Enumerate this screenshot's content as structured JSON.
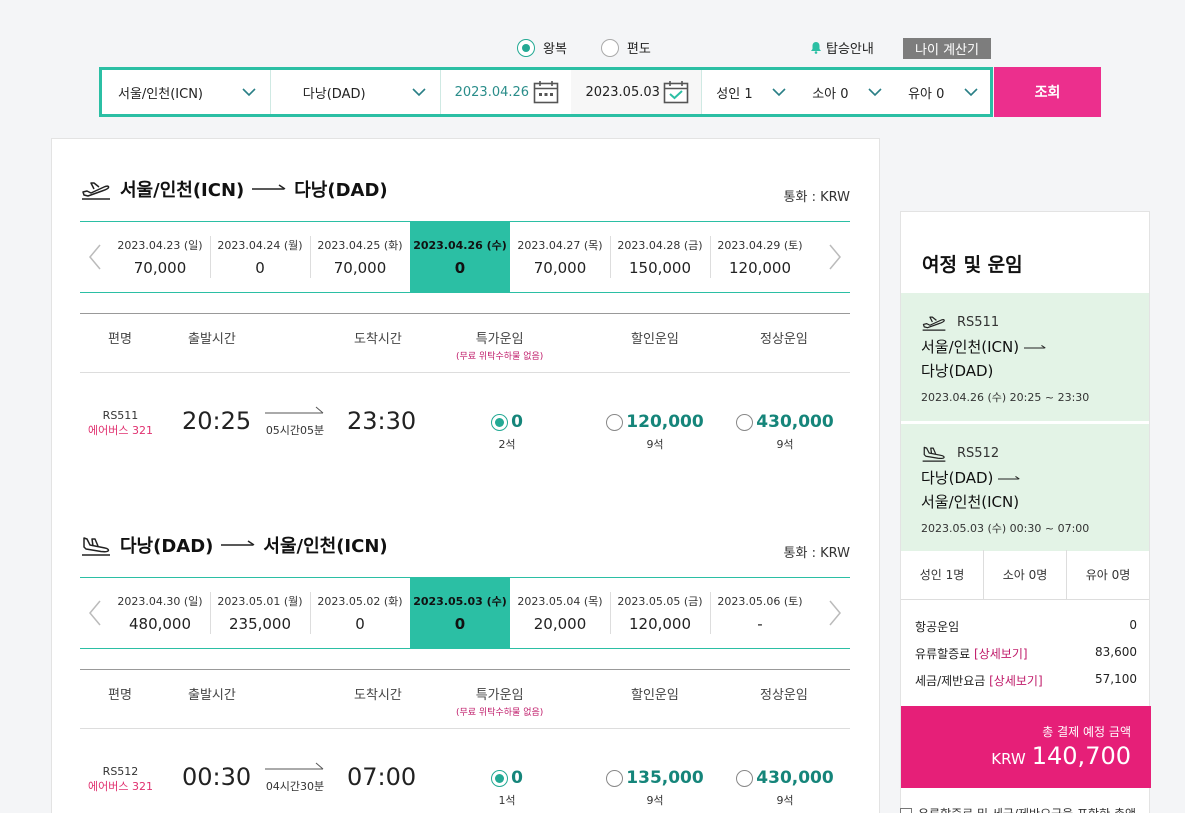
{
  "trip_type": {
    "options": [
      "왕복",
      "편도"
    ],
    "selected": 0
  },
  "boarding_info": "탑승안내",
  "age_calculator": "나이 계산기",
  "search": {
    "origin": "서울/인천(ICN)",
    "destination": "다낭(DAD)",
    "depart_date": "2023.04.26",
    "return_date": "2023.05.03",
    "adult": "성인 1",
    "child": "소아 0",
    "infant": "유아 0",
    "button": "조회"
  },
  "outbound": {
    "title_from": "서울/인천(ICN)",
    "title_to": "다낭(DAD)",
    "currency": "통화 : KRW",
    "dates": [
      {
        "date": "2023.04.23 (일)",
        "price": "70,000"
      },
      {
        "date": "2023.04.24 (월)",
        "price": "0"
      },
      {
        "date": "2023.04.25 (화)",
        "price": "70,000"
      },
      {
        "date": "2023.04.26 (수)",
        "price": "0"
      },
      {
        "date": "2023.04.27 (목)",
        "price": "70,000"
      },
      {
        "date": "2023.04.28 (금)",
        "price": "150,000"
      },
      {
        "date": "2023.04.29 (토)",
        "price": "120,000"
      }
    ],
    "active_index": 3,
    "headers": {
      "flight": "편명",
      "dep": "출발시간",
      "arr": "도착시간",
      "special": "특가운임",
      "special_note": "(무료 위탁수하물 없음)",
      "discount": "할인운임",
      "normal": "정상운임"
    },
    "flight": {
      "no": "RS511",
      "aircraft": "에어버스 321",
      "dep": "20:25",
      "arr": "23:30",
      "duration": "05시간05분",
      "fares": [
        {
          "price": "0",
          "seats": "2석",
          "selected": true
        },
        {
          "price": "120,000",
          "seats": "9석",
          "selected": false
        },
        {
          "price": "430,000",
          "seats": "9석",
          "selected": false
        }
      ]
    }
  },
  "inbound": {
    "title_from": "다낭(DAD)",
    "title_to": "서울/인천(ICN)",
    "currency": "통화 : KRW",
    "dates": [
      {
        "date": "2023.04.30 (일)",
        "price": "480,000"
      },
      {
        "date": "2023.05.01 (월)",
        "price": "235,000"
      },
      {
        "date": "2023.05.02 (화)",
        "price": "0"
      },
      {
        "date": "2023.05.03 (수)",
        "price": "0"
      },
      {
        "date": "2023.05.04 (목)",
        "price": "20,000"
      },
      {
        "date": "2023.05.05 (금)",
        "price": "120,000"
      },
      {
        "date": "2023.05.06 (토)",
        "price": "-"
      }
    ],
    "active_index": 3,
    "headers": {
      "flight": "편명",
      "dep": "출발시간",
      "arr": "도착시간",
      "special": "특가운임",
      "special_note": "(무료 위탁수하물 없음)",
      "discount": "할인운임",
      "normal": "정상운임"
    },
    "flight": {
      "no": "RS512",
      "aircraft": "에어버스 321",
      "dep": "00:30",
      "arr": "07:00",
      "duration": "04시간30분",
      "fares": [
        {
          "price": "0",
          "seats": "1석",
          "selected": true
        },
        {
          "price": "135,000",
          "seats": "9석",
          "selected": false
        },
        {
          "price": "430,000",
          "seats": "9석",
          "selected": false
        }
      ]
    }
  },
  "summary": {
    "title": "여정 및 운임",
    "seg1": {
      "flight": "RS511",
      "from": "서울/인천(ICN)",
      "to": "다낭(DAD)",
      "time": "2023.04.26 (수) 20:25 ~ 23:30"
    },
    "seg2": {
      "flight": "RS512",
      "from": "다낭(DAD)",
      "to": "서울/인천(ICN)",
      "time": "2023.05.03 (수) 00:30 ~ 07:00"
    },
    "pax": {
      "adult": "성인 1명",
      "child": "소아 0명",
      "infant": "유아 0명"
    },
    "fees": {
      "air_label": "항공운임",
      "air_value": "0",
      "fuel_label": "유류할증료",
      "fuel_link": "[상세보기]",
      "fuel_value": "83,600",
      "tax_label": "세금/제반요금",
      "tax_link": "[상세보기]",
      "tax_value": "57,100"
    },
    "total_label": "총 결제 예정 금액",
    "total_currency": "KRW",
    "total_value": "140,700",
    "agree_text": "유류할증료 및 세금/제반요금을 포함한 총액"
  },
  "colors": {
    "teal": "#2bbfa4",
    "pink": "#ec2f8d",
    "total_bg": "#e61f78",
    "seg_bg": "#e3f3e6"
  }
}
